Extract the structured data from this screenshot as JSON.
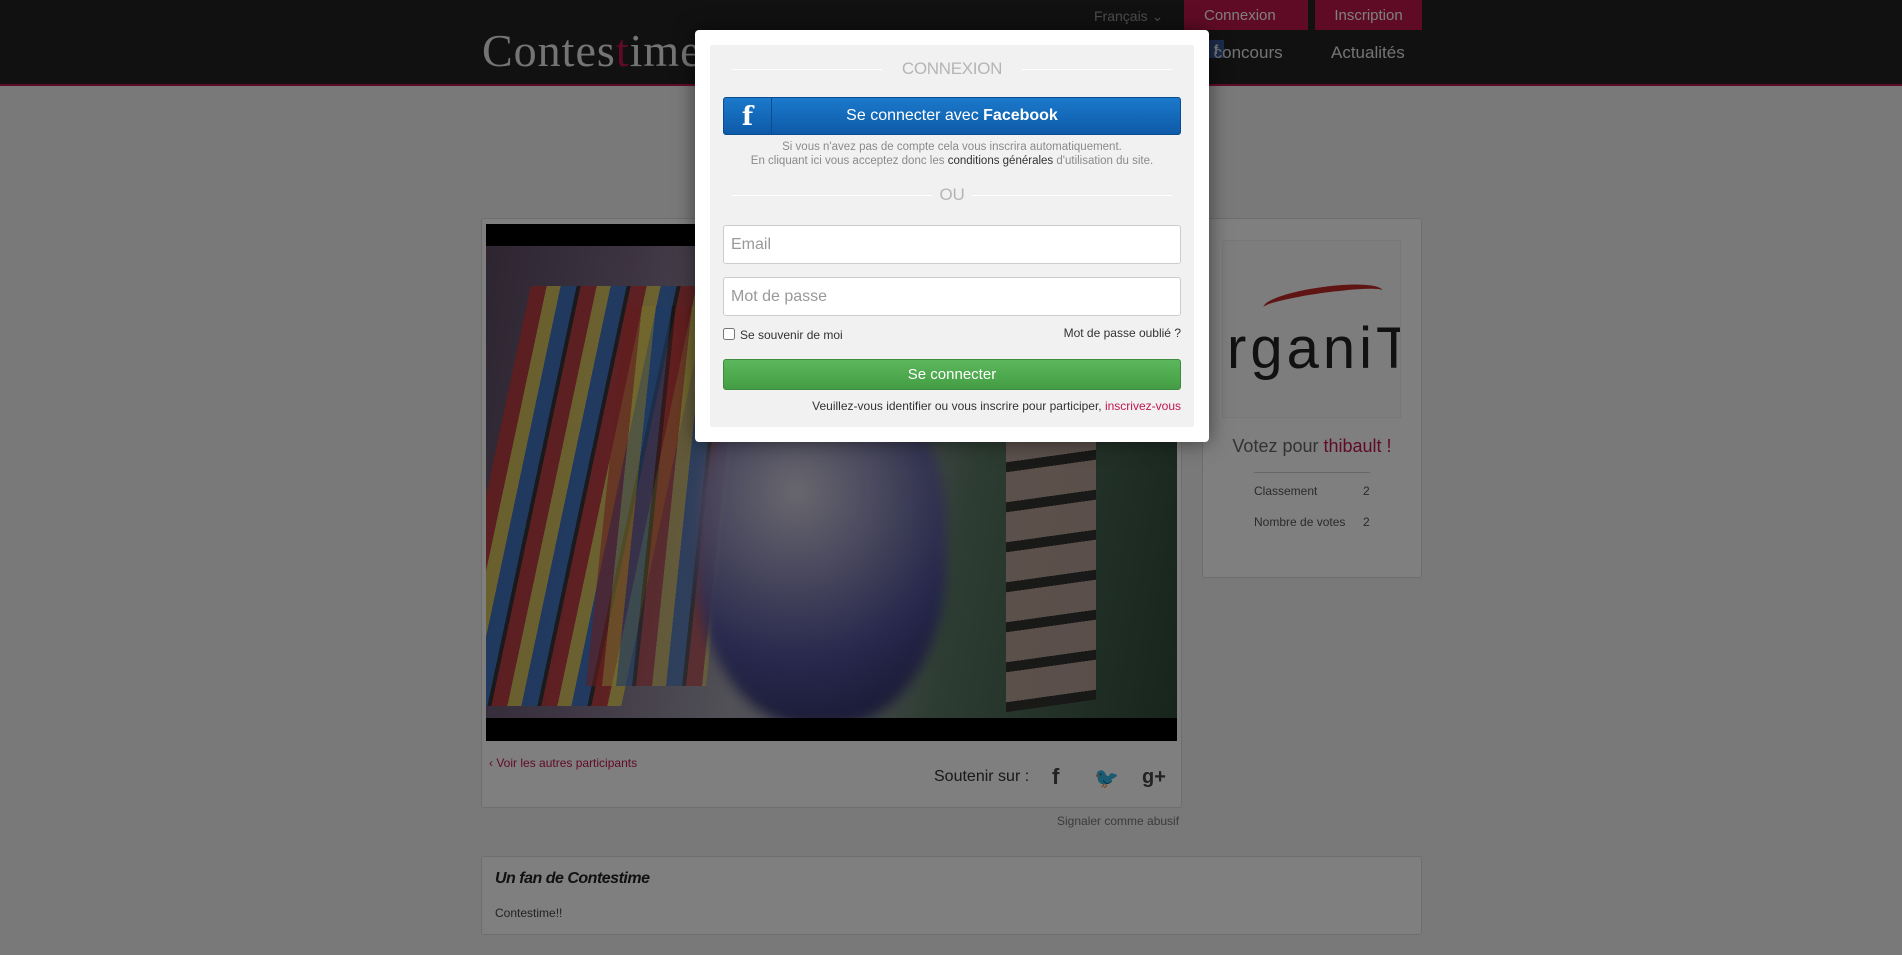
{
  "header": {
    "logo": {
      "part1": "Contes",
      "part2": "t",
      "part3": "ime"
    },
    "language": "Français",
    "login_label": "Connexion",
    "login_fb_glyph": "f",
    "signup_label": "Inscription",
    "nav": {
      "contest": "un concours",
      "news": "Actualités"
    }
  },
  "main": {
    "others_link": "Voir les autres participants",
    "support_label": "Soutenir sur :",
    "social": {
      "facebook": "f",
      "twitter": "🐦",
      "google_plus": "g+"
    },
    "report_label": "Signaler comme abusif"
  },
  "sidebar": {
    "brand_text": "rganiT",
    "vote_prefix": "Votez pour ",
    "candidate": "thibault",
    "vote_suffix": " !",
    "stats": [
      {
        "label": "Classement",
        "value": "2"
      },
      {
        "label": "Nombre de votes",
        "value": "2"
      }
    ]
  },
  "fan": {
    "title": "Un fan de Contestime",
    "text": "Contestime!!"
  },
  "modal": {
    "title": "CONNEXION",
    "facebook_button": {
      "prefix": "Se connecter avec ",
      "brand": "Facebook",
      "icon": "f"
    },
    "fine_print_line1": "Si vous n'avez pas de compte cela vous inscrira automatiquement.",
    "fine_print_line2_pre": "En cliquant ici vous acceptez donc les ",
    "fine_print_terms": "conditions générales",
    "fine_print_line2_post": " d'utilisation du site.",
    "or_label": "OU",
    "email_placeholder": "Email",
    "password_placeholder": "Mot de passe",
    "remember_label": "Se souvenir de moi",
    "forgot_label": "Mot de passe oublié ?",
    "submit_label": "Se connecter",
    "notice_text": "Veuillez-vous identifier ou vous inscrire pour participer, ",
    "notice_link": "inscrivez-vous"
  },
  "colors": {
    "brand": "#c0174d",
    "facebook": "#1565b8",
    "success": "#4cae4c"
  }
}
